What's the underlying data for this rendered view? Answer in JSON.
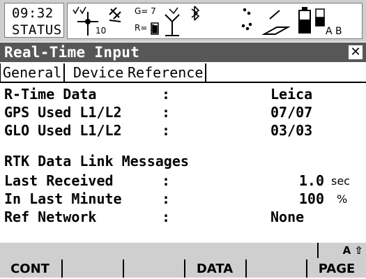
{
  "status": {
    "time": "09:32",
    "mode": "STATUS",
    "gps_count_label": "G= 7",
    "glo_count_label": "R= 3",
    "total_sats": "10",
    "icons": [
      "satellite-tracking-icon",
      "rtk-position-icon",
      "battery-radio-icon",
      "bluetooth-icon",
      "line-mode-icon",
      "pen-icon",
      "battery-icon",
      "memory-card-icon"
    ],
    "card_labels": "A B"
  },
  "window": {
    "title": "Real-Time Input",
    "close_label": "✕"
  },
  "tabs": [
    {
      "label": "General",
      "active": true
    },
    {
      "label": "Device",
      "active": false
    },
    {
      "label": "Reference",
      "active": false
    }
  ],
  "fields": {
    "rtime_data": {
      "label": "R-Time Data",
      "value": "Leica"
    },
    "gps_used": {
      "label": "GPS Used L1/L2",
      "value": "07/07"
    },
    "glo_used": {
      "label": "GLO Used L1/L2",
      "value": "03/03"
    },
    "section_heading": "RTK Data Link Messages",
    "last_received": {
      "label": "Last Received",
      "value": "1.0",
      "unit": "sec"
    },
    "in_last_minute": {
      "label": "In Last Minute",
      "value": "100",
      "unit": "%"
    },
    "ref_network": {
      "label": "Ref Network",
      "value": "None"
    },
    "colon": ":"
  },
  "shift": {
    "label": "A ⇧"
  },
  "softkeys": [
    "CONT",
    "",
    "",
    "DATA",
    "",
    "PAGE"
  ]
}
